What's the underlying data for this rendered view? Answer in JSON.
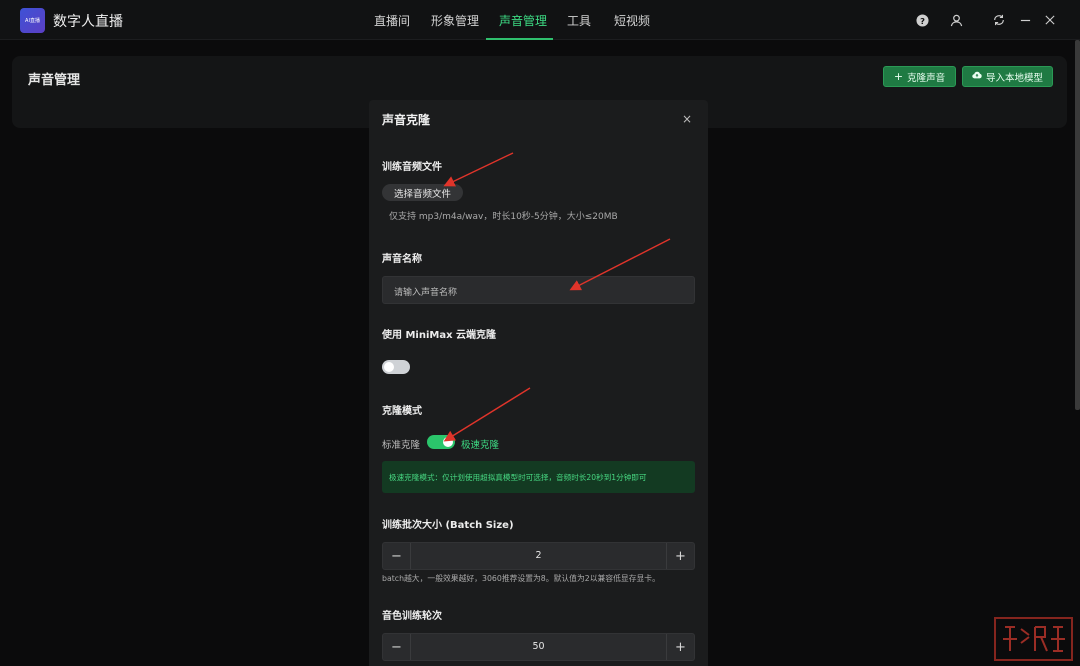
{
  "app": {
    "logo_text": "AI直播",
    "title": "数字人直播"
  },
  "nav": {
    "items": [
      {
        "label": "直播间"
      },
      {
        "label": "形象管理"
      },
      {
        "label": "声音管理",
        "active": true
      },
      {
        "label": "工具"
      },
      {
        "label": "短视频"
      }
    ]
  },
  "window_icons": [
    "help-icon",
    "user-icon",
    "refresh-icon",
    "minimize-icon",
    "close-icon"
  ],
  "page": {
    "title": "声音管理",
    "clone_button": "克隆声音",
    "import_button": "导入本地模型"
  },
  "modal": {
    "title": "声音克隆",
    "close_glyph": "×",
    "audio": {
      "label": "训练音频文件",
      "button": "选择音频文件",
      "hint": "仅支持 mp3/m4a/wav，时长10秒-5分钟，大小≤20MB"
    },
    "name": {
      "label": "声音名称",
      "placeholder": "请输入声音名称"
    },
    "minimax": {
      "label": "使用 MiniMax 云端克隆",
      "enabled": false
    },
    "mode": {
      "label": "克隆模式",
      "left_option": "标准克隆",
      "right_option": "极速克隆",
      "fast_enabled": true,
      "info": "极速克隆模式：仅计划使用超拟真模型时可选择，音频时长20秒到1分钟即可"
    },
    "batch": {
      "label": "训练批次大小 (Batch Size)",
      "value": "2",
      "hint": "batch越大，一般效果越好，3060推荐设置为8。默认值为2以兼容低显存显卡。"
    },
    "epochs": {
      "label": "音色训练轮次",
      "value": "50"
    },
    "stepper_minus": "−",
    "stepper_plus": "+"
  },
  "colors": {
    "accent": "#3ddc84",
    "button_green": "#1f7a43",
    "info_bg": "#133a22",
    "arrow": "#e0342a"
  }
}
